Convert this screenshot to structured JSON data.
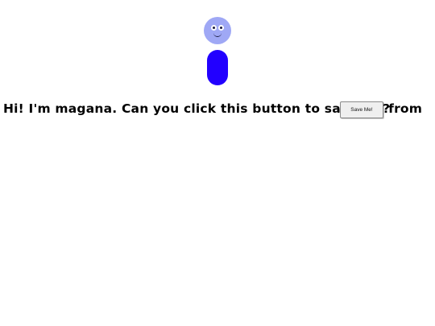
{
  "message": {
    "text": "Hi! I'm magana. Can you click this button to save me from",
    "trailing": "?"
  },
  "save_button": {
    "label": "Save Me!"
  },
  "character": {
    "head_color": "#9fa8f5",
    "body_color": "#2200ff"
  }
}
